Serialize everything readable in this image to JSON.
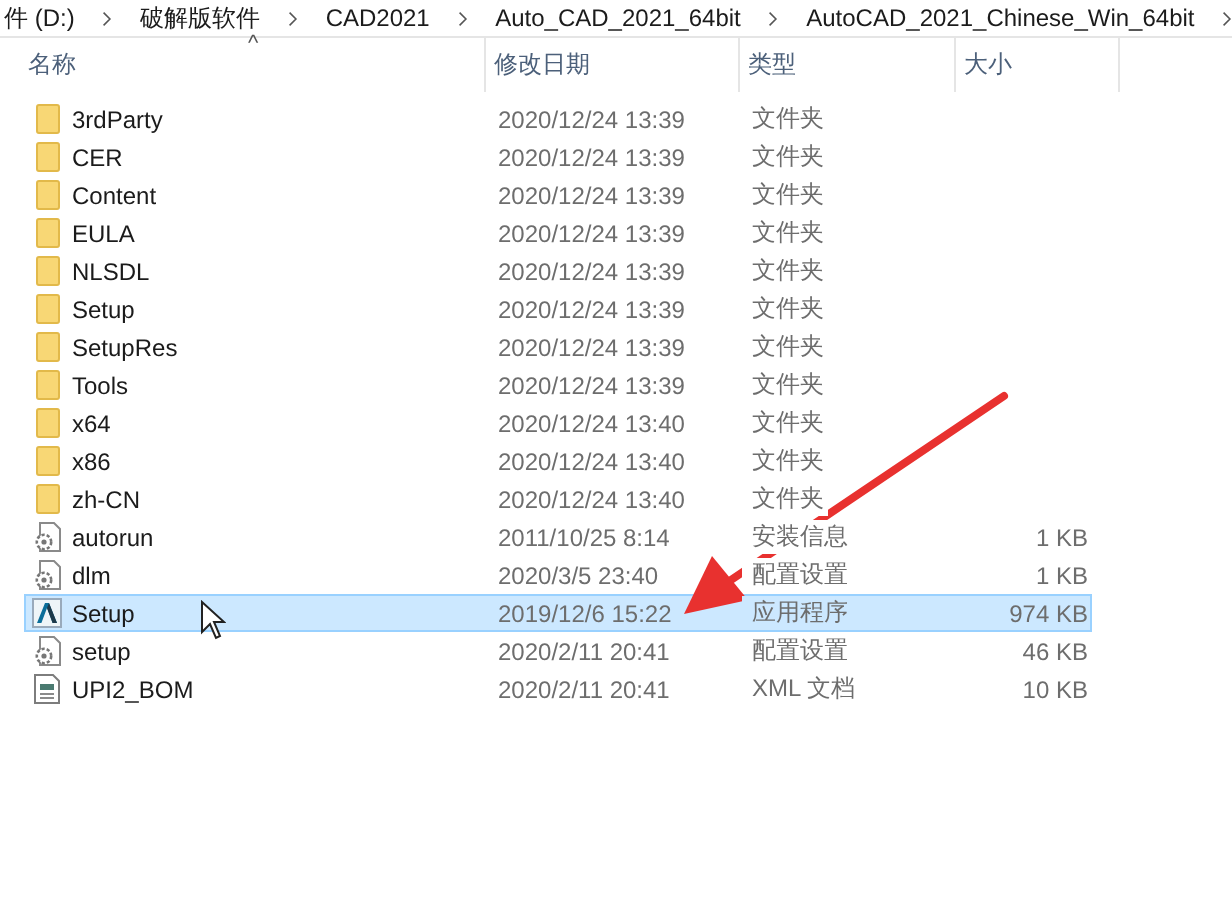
{
  "breadcrumb": [
    "件 (D:)",
    "破解版软件",
    "CAD2021",
    "Auto_CAD_2021_64bit",
    "AutoCAD_2021_Chinese_Win_64bit"
  ],
  "columns": [
    "名称",
    "修改日期",
    "类型",
    "大小"
  ],
  "sort_indicator": "^",
  "rows": [
    {
      "kind": "folder",
      "name": "3rdParty",
      "date": "2020/12/24 13:39",
      "type": "文件夹",
      "selected": false
    },
    {
      "kind": "folder",
      "name": "CER",
      "date": "2020/12/24 13:39",
      "type": "文件夹",
      "selected": false
    },
    {
      "kind": "folder",
      "name": "Content",
      "date": "2020/12/24 13:39",
      "type": "文件夹",
      "selected": false
    },
    {
      "kind": "folder",
      "name": "EULA",
      "date": "2020/12/24 13:39",
      "type": "文件夹",
      "selected": false
    },
    {
      "kind": "folder",
      "name": "NLSDL",
      "date": "2020/12/24 13:39",
      "type": "文件夹",
      "selected": false
    },
    {
      "kind": "folder",
      "name": "Setup",
      "date": "2020/12/24 13:39",
      "type": "文件夹",
      "selected": false
    },
    {
      "kind": "folder",
      "name": "SetupRes",
      "date": "2020/12/24 13:39",
      "type": "文件夹",
      "selected": false
    },
    {
      "kind": "folder",
      "name": "Tools",
      "date": "2020/12/24 13:39",
      "type": "文件夹",
      "selected": false
    },
    {
      "kind": "folder",
      "name": "x64",
      "date": "2020/12/24 13:40",
      "type": "文件夹",
      "selected": false
    },
    {
      "kind": "folder",
      "name": "x86",
      "date": "2020/12/24 13:40",
      "type": "文件夹",
      "selected": false
    },
    {
      "kind": "folder",
      "name": "zh-CN",
      "date": "2020/12/24 13:40",
      "type": "文件夹",
      "selected": false
    },
    {
      "kind": "config",
      "name": "autorun",
      "date": "2011/10/25 8:14",
      "type": "安装信息",
      "size": "1 KB",
      "selected": false
    },
    {
      "kind": "config",
      "name": "dlm",
      "date": "2020/3/5 23:40",
      "type": "配置设置",
      "size": "1 KB",
      "selected": false
    },
    {
      "kind": "app",
      "name": "Setup",
      "date": "2019/12/6 15:22",
      "type": "应用程序",
      "size": "974 KB",
      "selected": true
    },
    {
      "kind": "config",
      "name": "setup",
      "date": "2020/2/11 20:41",
      "type": "配置设置",
      "size": "46 KB",
      "selected": false
    },
    {
      "kind": "xml",
      "name": "UPI2_BOM",
      "date": "2020/2/11 20:41",
      "type": "XML 文档",
      "size": "10 KB",
      "selected": false
    }
  ]
}
